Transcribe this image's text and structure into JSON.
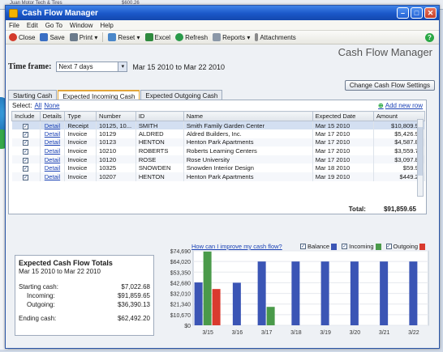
{
  "window": {
    "title": "Cash Flow Manager"
  },
  "bg": {
    "top_text": "Juan Motor Tech & Tires",
    "top_amount": "$600.26"
  },
  "menu": [
    "File",
    "Edit",
    "Go To",
    "Window",
    "Help"
  ],
  "toolbar": [
    {
      "label": "Close",
      "color": "#d33b2c"
    },
    {
      "label": "Save",
      "color": "#3a6fc4"
    },
    {
      "label": "Print ▾",
      "color": "#6b7b8c"
    },
    {
      "label": "Reset ▾",
      "color": "#4a87c9"
    },
    {
      "label": "Excel",
      "color": "#2f8a3e"
    },
    {
      "label": "Refresh",
      "color": "#2a9a4a"
    },
    {
      "label": "Reports ▾",
      "color": "#8b98a8"
    },
    {
      "label": "Attachments",
      "color": "#8a8a8a"
    }
  ],
  "page_title": "Cash Flow Manager",
  "timeframe": {
    "label": "Time frame:",
    "value": "Next 7 days",
    "range": "Mar 15 2010 to Mar 22 2010"
  },
  "change_settings": "Change Cash Flow Settings",
  "tabs": [
    "Starting Cash",
    "Expected Incoming Cash",
    "Expected Outgoing Cash"
  ],
  "select_row": {
    "label": "Select:",
    "all": "All",
    "none": "None",
    "add": "Add new row"
  },
  "columns": [
    "Include",
    "Details",
    "Type",
    "Number",
    "ID",
    "Name",
    "Expected Date",
    "Amount"
  ],
  "rows": [
    {
      "type": "Receipt",
      "number": "10125, 10...",
      "id": "SMITH",
      "name": "Smith Family Garden Center",
      "date": "Mar 15 2010",
      "amount": "$10,809.93"
    },
    {
      "type": "Invoice",
      "number": "10129",
      "id": "ALDRED",
      "name": "Aldred Builders, Inc.",
      "date": "Mar 17 2010",
      "amount": "$5,426.94"
    },
    {
      "type": "Invoice",
      "number": "10123",
      "id": "HENTON",
      "name": "Henton Park Apartments",
      "date": "Mar 17 2010",
      "amount": "$4,587.84"
    },
    {
      "type": "Invoice",
      "number": "10210",
      "id": "ROBERTS",
      "name": "Roberts Learning Centers",
      "date": "Mar 17 2010",
      "amount": "$3,559.74"
    },
    {
      "type": "Invoice",
      "number": "10120",
      "id": "ROSE",
      "name": "Rose University",
      "date": "Mar 17 2010",
      "amount": "$3,097.84"
    },
    {
      "type": "Invoice",
      "number": "10325",
      "id": "SNOWDEN",
      "name": "Snowden Interior Design",
      "date": "Mar 18 2010",
      "amount": "$59.98"
    },
    {
      "type": "Invoice",
      "number": "10207",
      "id": "HENTON",
      "name": "Henton Park Apartments",
      "date": "Mar 19 2010",
      "amount": "$449.29"
    }
  ],
  "detail_label": "Detail",
  "total": {
    "label": "Total:",
    "value": "$91,859.65"
  },
  "totals_box": {
    "title": "Expected Cash Flow Totals",
    "range": "Mar 15 2010 to Mar 22 2010",
    "starting_label": "Starting cash:",
    "starting": "$7,022.68",
    "incoming_label": "Incoming:",
    "incoming": "$91,859.65",
    "outgoing_label": "Outgoing:",
    "outgoing": "$36,390.13",
    "ending_label": "Ending cash:",
    "ending": "$62,492.20"
  },
  "chart_link": "How can I improve my cash flow?",
  "chart_data": {
    "type": "bar",
    "categories": [
      "3/15",
      "3/16",
      "3/17",
      "3/18",
      "3/19",
      "3/20",
      "3/21",
      "3/22"
    ],
    "yticks": [
      "$74,690",
      "$64,020",
      "$53,350",
      "$42,680",
      "$32,010",
      "$21,340",
      "$10,670",
      "$0"
    ],
    "ylim": [
      0,
      74690
    ],
    "series": [
      {
        "name": "Balance",
        "color": "#3b55b5",
        "values": [
          43000,
          42700,
          64000,
          64000,
          64000,
          64000,
          64000,
          64000
        ]
      },
      {
        "name": "Incoming",
        "color": "#4a9a4a",
        "values": [
          74000,
          0,
          18500,
          0,
          0,
          0,
          0,
          0
        ]
      },
      {
        "name": "Outgoing",
        "color": "#d93a2e",
        "values": [
          36400,
          0,
          0,
          0,
          0,
          0,
          0,
          0
        ]
      }
    ]
  }
}
